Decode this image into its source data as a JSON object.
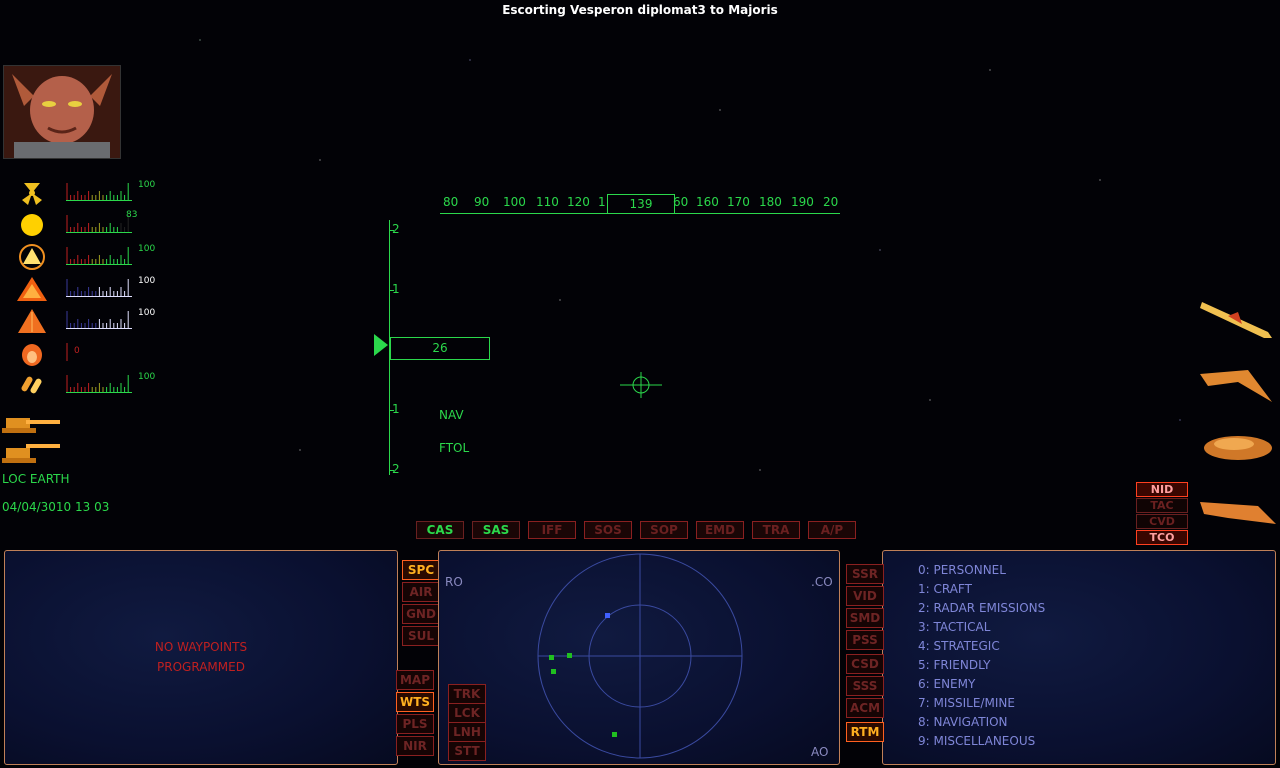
{
  "mission_title": "Escorting Vesperon diplomat3 to Majoris",
  "status_gauges": [
    {
      "icon": "radiation-icon",
      "value": "100",
      "level": 1.0,
      "color": "#2bd84b"
    },
    {
      "icon": "sun-icon",
      "value": "83",
      "level": 0.83,
      "color": "#2bd84b"
    },
    {
      "icon": "shield-triangle-icon",
      "value": "100",
      "level": 1.0,
      "color": "#2bd84b"
    },
    {
      "icon": "hull-triangle-icon",
      "value": "100",
      "level": 1.0,
      "color": "#ffffff"
    },
    {
      "icon": "armor-triangle-icon",
      "value": "100",
      "level": 1.0,
      "color": "#ffffff"
    },
    {
      "icon": "fuel-flame-icon",
      "value": "0",
      "level": 0.0,
      "color": "#c02020"
    },
    {
      "icon": "ammo-icon",
      "value": "100",
      "level": 1.0,
      "color": "#2bd84b"
    }
  ],
  "location": "LOC EARTH",
  "datetime": "04/04/3010 13 03",
  "heading": {
    "ticks": [
      "80",
      "90",
      "100",
      "110",
      "120",
      "1",
      "60",
      "160",
      "170",
      "180",
      "190",
      "20"
    ],
    "value": "139"
  },
  "altitude": {
    "ticks": [
      "2",
      "1",
      "1",
      "2"
    ],
    "value": "26"
  },
  "nav_label": "NAV",
  "ftol_label": "FTOL",
  "mode_buttons": [
    {
      "label": "CAS",
      "active": true
    },
    {
      "label": "SAS",
      "active": true
    },
    {
      "label": "IFF",
      "active": false
    },
    {
      "label": "SOS",
      "active": false
    },
    {
      "label": "SOP",
      "active": false
    },
    {
      "label": "EMD",
      "active": false
    },
    {
      "label": "TRA",
      "active": false
    },
    {
      "label": "A/P",
      "active": false
    }
  ],
  "left_panel": {
    "waypoint_line1": "NO WAYPOINTS",
    "waypoint_line2": "PROGRAMMED"
  },
  "env_buttons": [
    {
      "label": "SPC",
      "active": true
    },
    {
      "label": "AIR",
      "active": false
    },
    {
      "label": "GND",
      "active": false
    },
    {
      "label": "SUL",
      "active": false
    }
  ],
  "map_buttons": [
    {
      "label": "MAP",
      "active": false
    },
    {
      "label": "WTS",
      "active": true
    },
    {
      "label": "PLS",
      "active": false
    },
    {
      "label": "NIR",
      "active": false
    }
  ],
  "radar_buttons": [
    {
      "label": "TRK"
    },
    {
      "label": "LCK"
    },
    {
      "label": "LNH"
    },
    {
      "label": "STT"
    }
  ],
  "radar_labels": {
    "tl": "RO",
    "tr": ".CO",
    "br": "AO"
  },
  "radar_contacts": [
    {
      "type": "friendly",
      "color": "#20c020"
    },
    {
      "type": "friendly",
      "color": "#20c020"
    },
    {
      "type": "friendly",
      "color": "#20c020"
    },
    {
      "type": "friendly",
      "color": "#20c020"
    },
    {
      "type": "unknown",
      "color": "#4060ff"
    }
  ],
  "right_buttons": [
    {
      "label": "SSR",
      "active": false
    },
    {
      "label": "VID",
      "active": false
    },
    {
      "label": "SMD",
      "active": false
    },
    {
      "label": "PSS",
      "active": false
    },
    {
      "label": "CSD",
      "active": false
    },
    {
      "label": "SSS",
      "active": false
    },
    {
      "label": "ACM",
      "active": false
    },
    {
      "label": "RTM",
      "active": true
    }
  ],
  "menu_items": [
    "0: PERSONNEL",
    "1: CRAFT",
    "2: RADAR EMISSIONS",
    "3: TACTICAL",
    "4: STRATEGIC",
    "5: FRIENDLY",
    "6: ENEMY",
    "7: MISSILE/MINE",
    "8: NAVIGATION",
    "9: MISCELLANEOUS"
  ],
  "target_tags": [
    {
      "label": "NID",
      "active": true
    },
    {
      "label": "TAC",
      "active": false
    },
    {
      "label": "CVD",
      "active": false
    },
    {
      "label": "TCO",
      "active": true
    }
  ],
  "colors": {
    "hud": "#2bd84b",
    "alert": "#c02020",
    "menu": "#7f86d8",
    "accent": "#ffb020"
  }
}
